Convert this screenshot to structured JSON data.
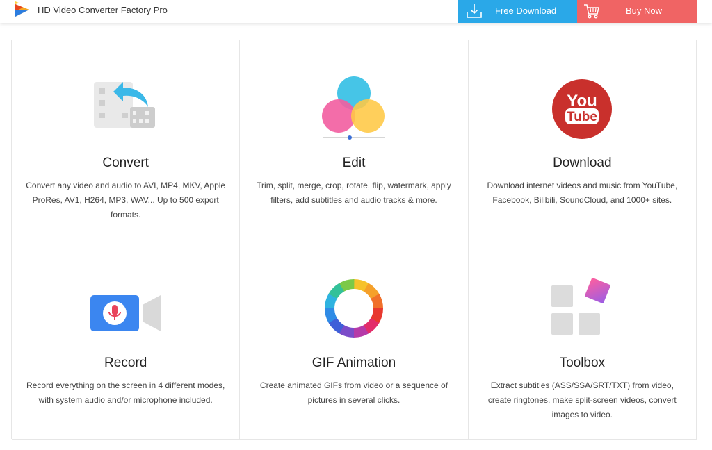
{
  "header": {
    "app_name": "HD Video Converter Factory Pro",
    "free_download_label": "Free Download",
    "buy_now_label": "Buy Now",
    "colors": {
      "free_download": "#2aa8e8",
      "buy_now": "#f06464"
    }
  },
  "features": [
    {
      "icon": "video-convert-icon",
      "title": "Convert",
      "description": "Convert any video and audio to AVI, MP4, MKV, Apple ProRes, AV1, H264, MP3, WAV... Up to 500 export formats."
    },
    {
      "icon": "color-circles-icon",
      "title": "Edit",
      "description": "Trim, split, merge, crop, rotate, flip, watermark, apply filters, add subtitles and audio tracks & more."
    },
    {
      "icon": "youtube-icon",
      "title": "Download",
      "description": "Download internet videos and music from YouTube, Facebook, Bilibili, SoundCloud, and 1000+ sites."
    },
    {
      "icon": "video-camera-mic-icon",
      "title": "Record",
      "description": "Record everything on the screen in 4 different modes, with system audio and/or microphone included."
    },
    {
      "icon": "color-ring-icon",
      "title": "GIF Animation",
      "description": "Create animated GIFs from video or a sequence of pictures in several clicks."
    },
    {
      "icon": "toolbox-tiles-icon",
      "title": "Toolbox",
      "description": "Extract subtitles (ASS/SSA/SRT/TXT) from video, create ringtones, make split-screen videos, convert images to video."
    }
  ]
}
